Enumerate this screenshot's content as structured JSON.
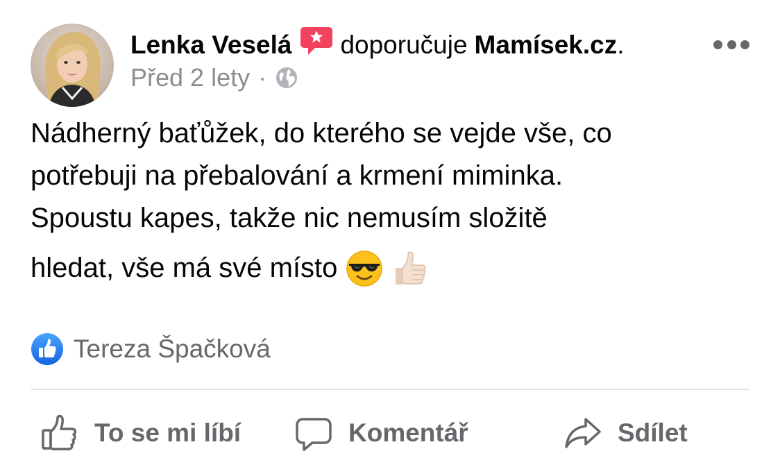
{
  "post": {
    "author": "Lenka Veselá",
    "verb": "doporučuje",
    "page_name": "Mamísek.cz",
    "page_suffix": ".",
    "time": "Před 2 lety",
    "separator": "·",
    "privacy_icon": "globe-icon",
    "text_lines": [
      "Nádherný baťůžek, do kterého se vejde vše, co",
      "potřebuji na přebalování a krmení miminka.",
      "Spoustu kapes, takže nic nemusím složitě",
      "hledat, vše má své místo"
    ],
    "emojis": [
      "sunglasses-emoji",
      "thumbs-up-emoji"
    ]
  },
  "reactions": {
    "icon": "like-icon",
    "names": "Tereza Špačková"
  },
  "actions": {
    "like_label": "To se mi líbí",
    "comment_label": "Komentář",
    "share_label": "Sdílet"
  },
  "colors": {
    "text_primary": "#050505",
    "text_secondary": "#65676b",
    "meta_gray": "#8a8d91",
    "like_blue": "#1877f2",
    "recommend_red": "#f3425f",
    "divider": "#e4e6eb"
  }
}
